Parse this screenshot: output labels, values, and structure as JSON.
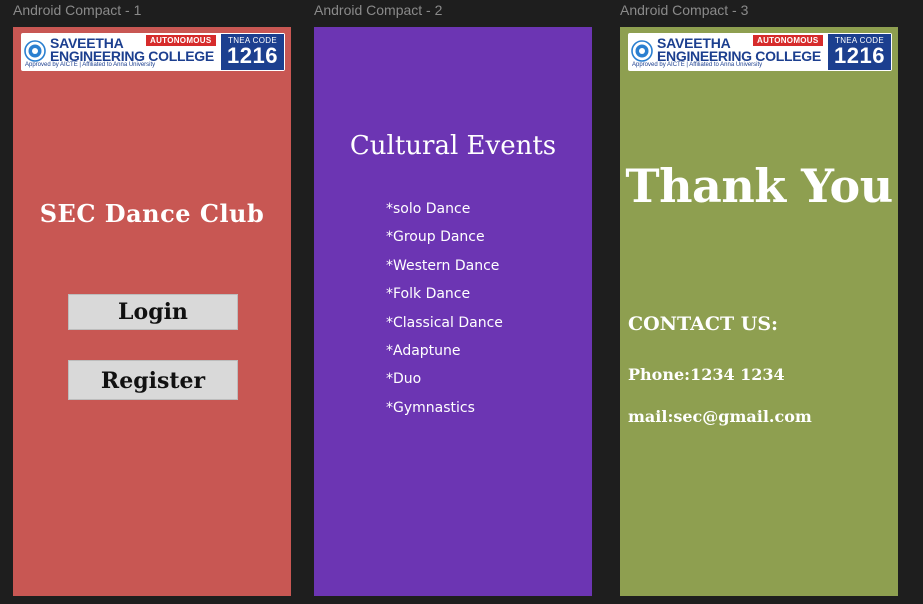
{
  "frames": [
    {
      "title": "Android Compact - 1",
      "bg": "#c85753"
    },
    {
      "title": "Android Compact - 2",
      "bg": "#6c35b3"
    },
    {
      "title": "Android Compact - 3",
      "bg": "#8e9f50"
    }
  ],
  "logo": {
    "name_line1": "SAVEETHA",
    "name_line2": "ENGINEERING COLLEGE",
    "autonomous": "AUTONOMOUS",
    "approved": "Approved by AICTE  |  Affiliated to Anna University",
    "tnea_label": "TNEA CODE",
    "tnea_code": "1216",
    "emblem_icon": "college-emblem-icon",
    "colors": {
      "navy": "#1c3f8f",
      "red": "#d62b2b"
    }
  },
  "screen1": {
    "title": "SEC Dance Club",
    "login_label": "Login",
    "register_label": "Register"
  },
  "screen2": {
    "title": "Cultural Events",
    "events": [
      "*solo Dance",
      "*Group Dance",
      "*Western Dance",
      "*Folk Dance",
      "*Classical Dance",
      "*Adaptune",
      "*Duo",
      "*Gymnastics"
    ]
  },
  "screen3": {
    "title": "Thank You",
    "contact_heading": "CONTACT US:",
    "phone": "Phone:1234 1234",
    "mail": "mail:sec@gmail.com"
  }
}
